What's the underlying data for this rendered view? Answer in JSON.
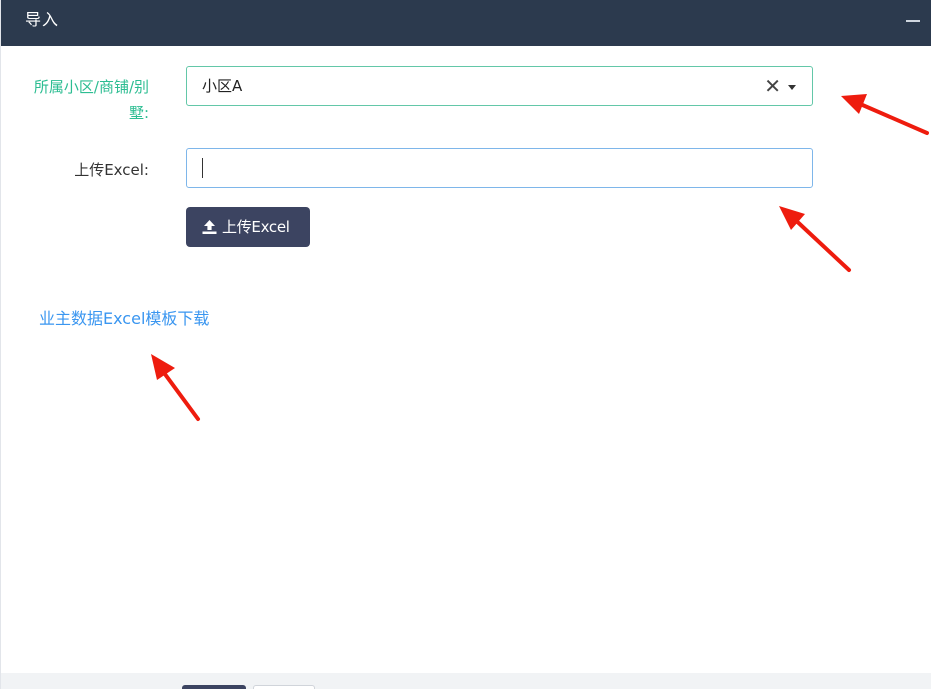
{
  "window": {
    "title": "导入"
  },
  "form": {
    "community_label": "所属小区/商铺/别墅:",
    "community_value": "小区A",
    "clear_symbol": "✕",
    "upload_label": "上传Excel:",
    "upload_value": "",
    "upload_button_label": "上传Excel"
  },
  "links": {
    "template_download": "业主数据Excel模板下载"
  },
  "colors": {
    "titlebar": "#2c3a4e",
    "label_highlight": "#2dbd92",
    "select_border": "#63c7a8",
    "input_focus_border": "#7eb6ea",
    "button_bg": "#3c4461",
    "link": "#3a96f0",
    "annotation_arrow": "#ee1c0e"
  },
  "icons": {
    "minimize": "minimize-icon",
    "clear": "clear-icon",
    "dropdown": "chevron-down-icon",
    "upload": "upload-icon",
    "annotation": "red-arrow-annotation"
  }
}
